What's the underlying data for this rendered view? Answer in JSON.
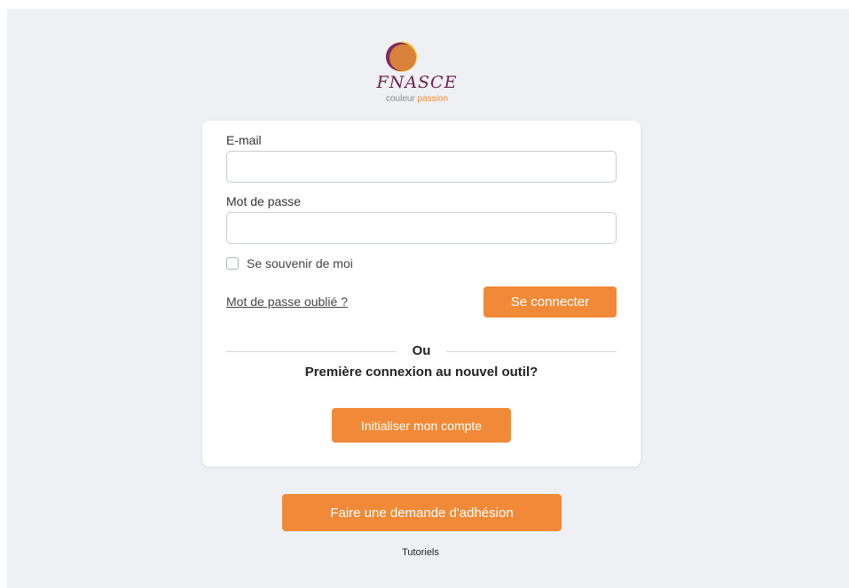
{
  "brand": {
    "name": "FNASCE",
    "tagline_part1": "couleur ",
    "tagline_part2": "passion",
    "colors": {
      "accent": "#f08a38",
      "logo_sun": "#d9823a",
      "logo_ring_purple": "#7b2a63",
      "logo_ring_yellow": "#f2c12e"
    }
  },
  "login_form": {
    "email_label": "E-mail",
    "email_value": "",
    "password_label": "Mot de passe",
    "password_value": "",
    "remember_label": "Se souvenir de moi",
    "remember_checked": false,
    "forgot_link": "Mot de passe oublié ?",
    "submit_label": "Se connecter"
  },
  "separator": {
    "text": "Ou"
  },
  "first_connection": {
    "question": "Première connexion au nouvel outil?",
    "button_label": "Initialiser mon compte"
  },
  "footer": {
    "membership_button": "Faire une demande d'adhésion",
    "tutorials_link": "Tutoriels"
  },
  "icons": [
    "fnasce-logo-icon",
    "checkbox-icon"
  ]
}
